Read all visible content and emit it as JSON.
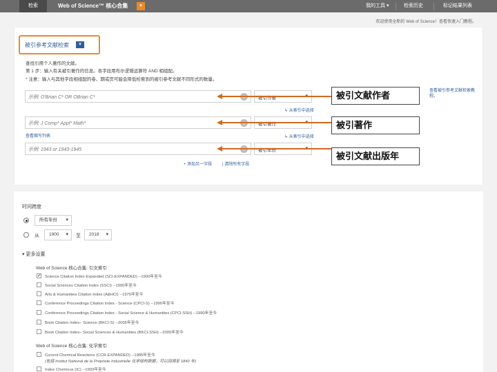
{
  "topbar": {
    "search_tab": "检索",
    "brand": "Web of Science™ 核心合集",
    "brand_dropdown": "▾",
    "tools": "我的工具 ▾",
    "history": "检索历史",
    "marked_list": "标记结果列表"
  },
  "notice": "欢迎使用全新的 Web of Science！查看快速入门教程。",
  "search_type": {
    "label": "被引参考文献检索",
    "chevron": "▾"
  },
  "instructions": [
    "查找引用个人著作的文献。",
    "第 1 步：输入有关被引著作的信息。各字段用布尔逻辑运算符 AND 相组配。",
    "* 注意：输入与其他字段相组配的卷、期或页可能会降低检索到的被引参考文献不同形式的数量。"
  ],
  "fields": [
    {
      "placeholder": "示例: O'Brian C* OR OBrian C*",
      "select": "被引作者",
      "link": "从索引中选择",
      "callout": "被引文献作者"
    },
    {
      "placeholder": "示例: J Comp* Appl* Math*",
      "select": "被引著作",
      "link": "从索引中选择",
      "callout": "被引著作"
    },
    {
      "placeholder": "示例: 1943 or 1943-1945",
      "select": "被引年份",
      "callout": "被引文献出版年"
    }
  ],
  "lookup_abbrev": "查看缩写列表",
  "side_hint": "查看被引参考文献检索教程。",
  "add_row": "+ 添加另一字段",
  "reset": "| 清除所有字段",
  "timespan": {
    "label": "时间跨度",
    "all_years": "所有年份",
    "from_label": "从",
    "from": "1900",
    "to_label": "至",
    "to": "2018"
  },
  "more_settings": "▾ 更多设置",
  "index_groups": [
    {
      "heading": "Web of Science 核心合集: 引文索引",
      "items": [
        {
          "checked": true,
          "text": "Science Citation Index Expanded (SCI-EXPANDED) --1900年至今"
        },
        {
          "checked": false,
          "text": "Social Sciences Citation Index (SSCI) --1900年至今"
        },
        {
          "checked": false,
          "text": "Arts & Humanities Citation Index (A&HCI) --1975年至今"
        },
        {
          "checked": false,
          "text": "Conference Proceedings Citation Index - Science (CPCI-S) --1990年至今"
        },
        {
          "checked": false,
          "text": "Conference Proceedings Citation Index - Social Science & Humanities (CPCI-SSH) --1990年至今"
        },
        {
          "checked": false,
          "text": "Book Citation Index– Science (BKCI-S) --2005年至今"
        },
        {
          "checked": false,
          "text": "Book Citation Index– Social Sciences & Humanities (BKCI-SSH) --2005年至今"
        }
      ]
    },
    {
      "heading": "Web of Science 核心合集: 化学索引",
      "items": [
        {
          "checked": false,
          "text": "Current Chemical Reactions (CCR-EXPANDED) --1985年至今",
          "sub": "(包括 Institut National de la Propriete Industrielle 化学结构数据，可以回溯至 1840 年)"
        },
        {
          "checked": false,
          "text": "Index Chemicus (IC) --1993年至今"
        }
      ]
    }
  ]
}
